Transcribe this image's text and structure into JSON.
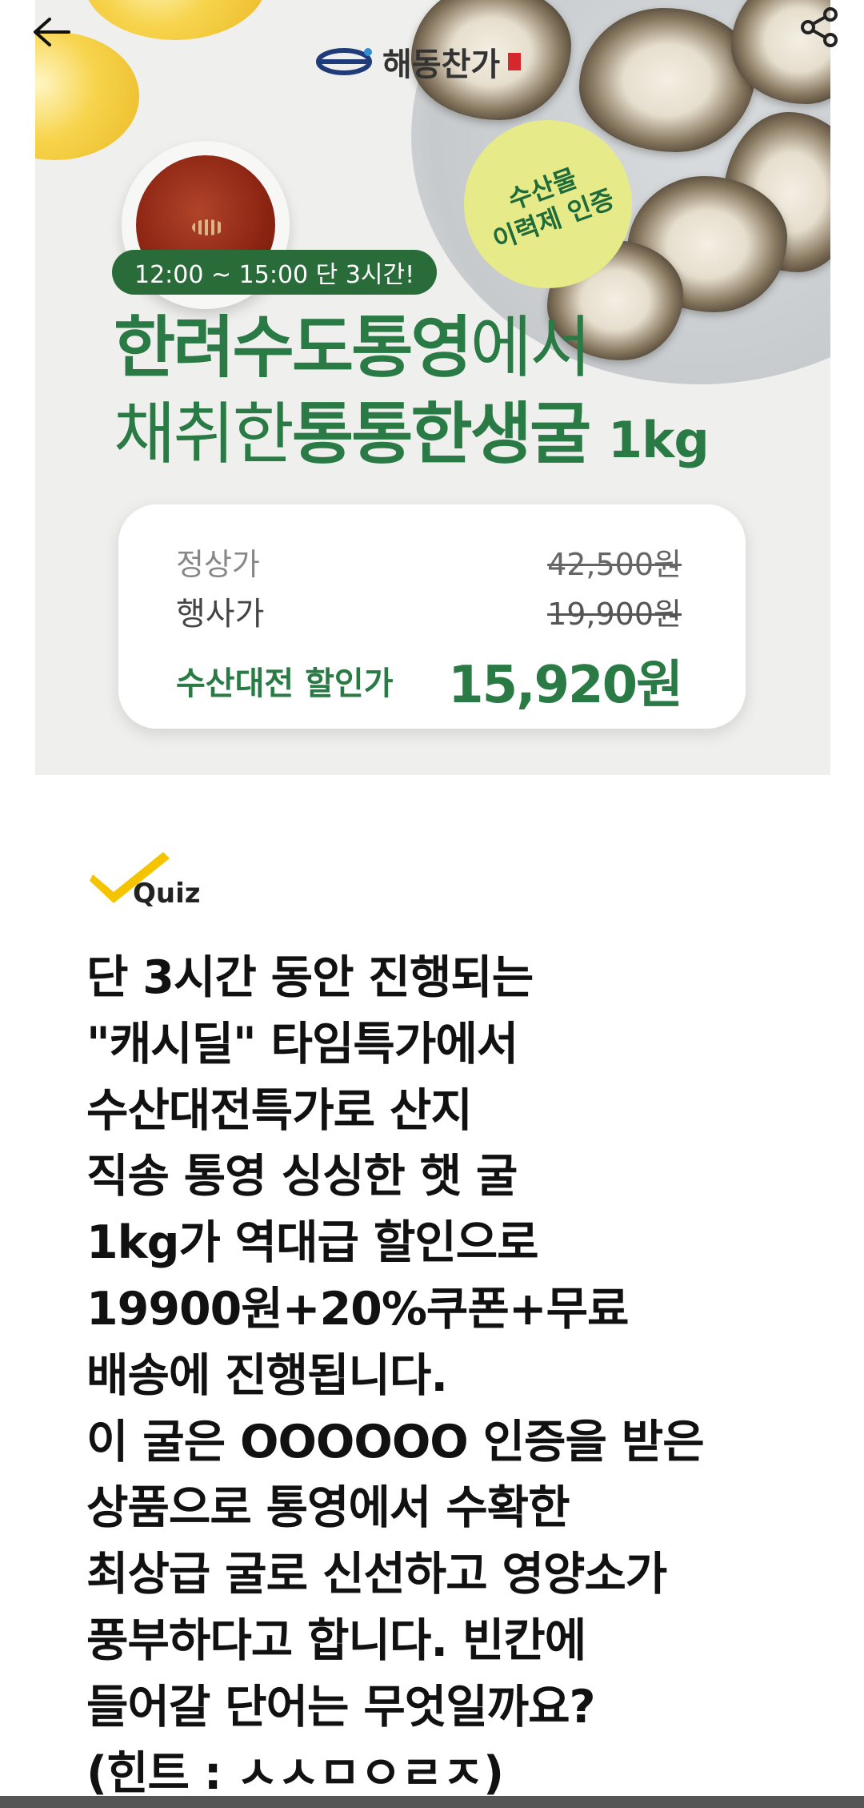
{
  "nav": {
    "back_icon": "arrow-left-icon",
    "share_icon": "share-icon"
  },
  "banner": {
    "brand": "해동찬가",
    "cert_badge": [
      "수산물",
      "이력제 인증"
    ],
    "time_pill": "12:00 ~ 15:00 단 3시간!",
    "headline_line1": {
      "bold": "한려수도통영",
      "light": "에서"
    },
    "headline_line2": {
      "light": "채취한",
      "bold": "통통한생굴",
      "unit": "1kg"
    },
    "prices": [
      {
        "label": "정상가",
        "value": "42,500원"
      },
      {
        "label": "행사가",
        "value": "19,900원"
      },
      {
        "label": "수산대전 할인가",
        "value": "15,920원"
      }
    ],
    "colors": {
      "brand_green": "#2a7a45",
      "pill_green": "#2a6b3a",
      "badge_yellow": "#e6ea88"
    }
  },
  "quiz": {
    "label": "Quiz",
    "check_icon": "checkmark-icon",
    "check_color": "#f5c400",
    "lines": [
      "단 3시간 동안 진행되는",
      "\"캐시딜\" 타임특가에서",
      "수산대전특가로 산지",
      "직송 통영 싱싱한 햇 굴",
      "1kg가 역대급 할인으로",
      "19900원+20%쿠폰+무료",
      "배송에 진행됩니다.",
      "이 굴은 OOOOOO 인증을 받은",
      "상품으로 통영에서 수확한",
      "최상급 굴로 신선하고 영양소가",
      "풍부하다고 합니다. 빈칸에",
      "들어갈 단어는 무엇일까요?",
      "(힌트 : ㅅㅅㅁㅇㄹㅈ)"
    ]
  }
}
